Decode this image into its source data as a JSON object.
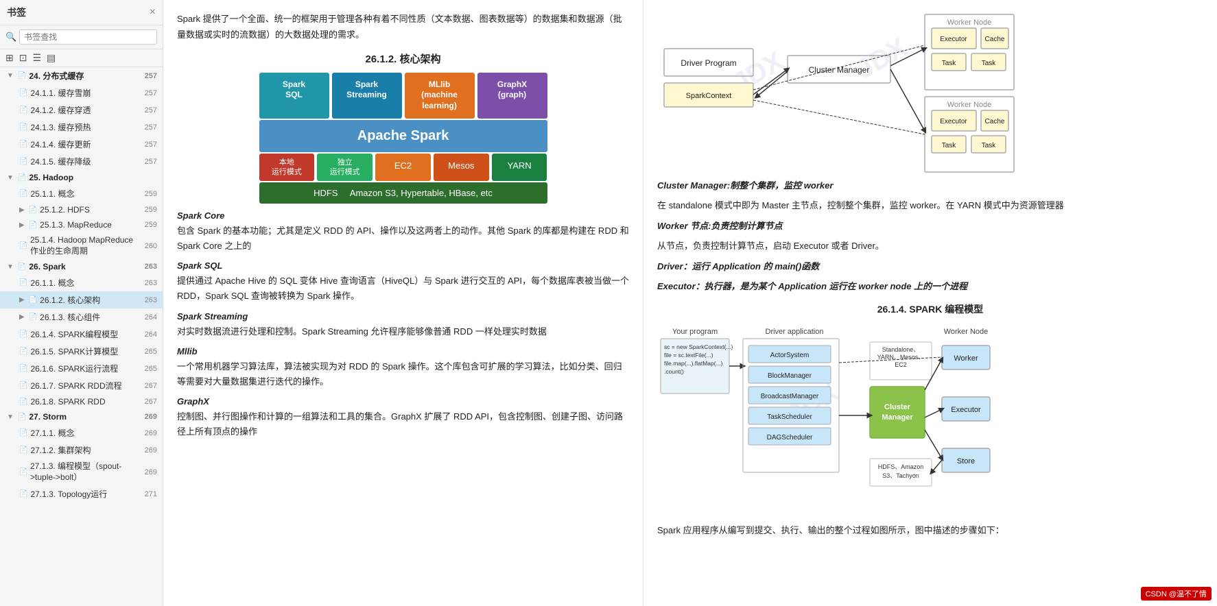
{
  "sidebar": {
    "title": "书签",
    "search_placeholder": "书签查找",
    "close_icon": "×",
    "toolbar_icons": [
      "⊞",
      "⊡",
      "☰",
      "▤"
    ],
    "items": [
      {
        "id": "s24",
        "level": 0,
        "label": "24. 分布式缓存",
        "page": "257",
        "collapsed": false,
        "active": false,
        "has_arrow": true,
        "arrow": "▼"
      },
      {
        "id": "s24_1",
        "level": 1,
        "label": "24.1.1. 缓存雪崩",
        "page": "257",
        "active": false
      },
      {
        "id": "s24_2",
        "level": 1,
        "label": "24.1.2. 缓存穿透",
        "page": "257",
        "active": false
      },
      {
        "id": "s24_3",
        "level": 1,
        "label": "24.1.3. 缓存预热",
        "page": "257",
        "active": false
      },
      {
        "id": "s24_4",
        "level": 1,
        "label": "24.1.4. 缓存更新",
        "page": "257",
        "active": false
      },
      {
        "id": "s24_5",
        "level": 1,
        "label": "24.1.5. 缓存降级",
        "page": "257",
        "active": false
      },
      {
        "id": "s25",
        "level": 0,
        "label": "25. Hadoop",
        "page": "",
        "collapsed": false,
        "active": false,
        "has_arrow": true,
        "arrow": "▼"
      },
      {
        "id": "s25_1",
        "level": 1,
        "label": "25.1.1. 概念",
        "page": "259",
        "active": false
      },
      {
        "id": "s25_2",
        "level": 1,
        "label": "25.1.2. HDFS",
        "page": "259",
        "active": false,
        "has_arrow": true,
        "arrow": "▶"
      },
      {
        "id": "s25_3",
        "level": 1,
        "label": "25.1.3. MapReduce",
        "page": "259",
        "active": false,
        "has_arrow": true,
        "arrow": "▶"
      },
      {
        "id": "s25_4",
        "level": 1,
        "label": "25.1.4. Hadoop MapReduce 作业的生命周期",
        "page": "260",
        "active": false
      },
      {
        "id": "s26",
        "level": 0,
        "label": "26. Spark",
        "page": "263",
        "collapsed": false,
        "active": false,
        "has_arrow": true,
        "arrow": "▼"
      },
      {
        "id": "s26_1",
        "level": 1,
        "label": "26.1.1. 概念",
        "page": "263",
        "active": false
      },
      {
        "id": "s26_2",
        "level": 1,
        "label": "26.1.2. 核心架构",
        "page": "263",
        "active": true
      },
      {
        "id": "s26_3",
        "level": 1,
        "label": "26.1.3. 核心组件",
        "page": "264",
        "active": false,
        "has_arrow": true,
        "arrow": "▶"
      },
      {
        "id": "s26_4",
        "level": 1,
        "label": "26.1.4. SPARK编程模型",
        "page": "264",
        "active": false
      },
      {
        "id": "s26_5",
        "level": 1,
        "label": "26.1.5. SPARK计算模型",
        "page": "265",
        "active": false
      },
      {
        "id": "s26_6",
        "level": 1,
        "label": "26.1.6. SPARK运行流程",
        "page": "265",
        "active": false
      },
      {
        "id": "s26_7",
        "level": 1,
        "label": "26.1.7. SPARK RDD流程",
        "page": "267",
        "active": false
      },
      {
        "id": "s26_8",
        "level": 1,
        "label": "26.1.8. SPARK RDD",
        "page": "267",
        "active": false
      },
      {
        "id": "s27",
        "level": 0,
        "label": "27. Storm",
        "page": "269",
        "collapsed": false,
        "active": false,
        "has_arrow": true,
        "arrow": "▼"
      },
      {
        "id": "s27_1",
        "level": 1,
        "label": "27.1.1. 概念",
        "page": "269",
        "active": false
      },
      {
        "id": "s27_2",
        "level": 1,
        "label": "27.1.2. 集群架构",
        "page": "269",
        "active": false
      },
      {
        "id": "s27_3",
        "level": 1,
        "label": "27.1.3. 编程模型（spout->tuple->bolt）",
        "page": "269",
        "active": false
      },
      {
        "id": "s27_4",
        "level": 1,
        "label": "27.1.3. Topology运行",
        "page": "271",
        "active": false
      }
    ]
  },
  "content": {
    "intro_text": "Spark 提供了一个全面、统一的框架用于管理各种有着不同性质（文本数据、图表数据等）的数据集和数据源（批量数据或实时的流数据）的大数据处理的需求。",
    "section_heading": "26.1.2.    核心架构",
    "arch_diagram": {
      "row1": [
        {
          "label": "Spark\nSQL",
          "color": "blue"
        },
        {
          "label": "Spark\nStreaming",
          "color": "blue2"
        },
        {
          "label": "MLlib\n(machine\nlearning)",
          "color": "orange"
        },
        {
          "label": "GraphX\n(graph)",
          "color": "purple"
        }
      ],
      "spark_row": "Apache Spark",
      "row3": [
        {
          "label": "本地\n运行模式",
          "color": "red"
        },
        {
          "label": "独立\n运行模式",
          "color": "green"
        },
        {
          "label": "EC2",
          "color": "orange2"
        },
        {
          "label": "Mesos",
          "color": "orange3"
        },
        {
          "label": "YARN",
          "color": "darkgreen"
        }
      ],
      "storage_row": "HDFS    Amazon S3, Hypertable, HBase, etc"
    },
    "components": [
      {
        "title": "Spark Core",
        "desc": "包含 Spark 的基本功能；尤其是定义 RDD 的 API、操作以及这两者上的动作。其他 Spark 的库都是构建在 RDD 和 Spark Core 之上的"
      },
      {
        "title": "Spark SQL",
        "desc": "提供通过 Apache Hive 的 SQL 变体 Hive 查询语言（HiveQL）与 Spark 进行交互的 API，每个数据库表被当做一个 RDD，Spark SQL 查询被转换为 Spark 操作。"
      },
      {
        "title": "Spark Streaming",
        "desc": "对实时数据流进行处理和控制。Spark Streaming 允许程序能够像普通 RDD 一样处理实时数据"
      },
      {
        "title": "Mllib",
        "desc": "一个常用机器学习算法库，算法被实现为对 RDD 的 Spark 操作。这个库包含可扩展的学习算法，比如分类、回归等需要对大量数据集进行迭代的操作。"
      },
      {
        "title": "GraphX",
        "desc": "控制图、并行图操作和计算的一组算法和工具的集合。GraphX 扩展了 RDD API，包含控制图、创建子图、访问路径上所有顶点的操作"
      }
    ]
  },
  "right": {
    "cluster_manager_label": "Cluster Manager:制整个集群，监控 worker",
    "cluster_manager_desc": "在 standalone 模式中即为 Master 主节点，控制整个集群，监控 worker。在 YARN 模式中为资源管理器",
    "worker_label": "Worker 节点:负责控制计算节点",
    "worker_desc": "从节点，负责控制计算节点，启动 Executor 或者 Driver。",
    "driver_label": "Driver：运行 Application 的 main()函数",
    "executor_label": "Executor：执行器，是为某个 Application 运行在 worker node 上的一个进程",
    "prog_heading": "26.1.4.    SPARK 编程模型",
    "footer_text": "Spark 应用程序从编写到提交、执行、输出的整个过程如图所示，图中描述的步骤如下：",
    "diagram": {
      "your_program": "Your program",
      "driver_application": "Driver application",
      "worker_node": "Worker Node",
      "actorSystem": "ActorSystem",
      "blockManager": "BlockManager",
      "broadcastManager": "BroadcastManager",
      "taskScheduler": "TaskScheduler",
      "dagScheduler": "DAGScheduler",
      "clusterManager": "Cluster\nManager",
      "worker": "Worker",
      "executor": "Executor",
      "store": "Store",
      "standalone": "Standalone、\nYARN、Mesos、\nEC2",
      "hdfs": "HDFS、Amazon\nS3、Tachyon",
      "code": "sc = new SparkContext(...)\nfile = sc.textFile(...)\nfile.map(...).flatMap(...)\n.count()"
    }
  },
  "csdn_badge": "CSDN @温不了情"
}
